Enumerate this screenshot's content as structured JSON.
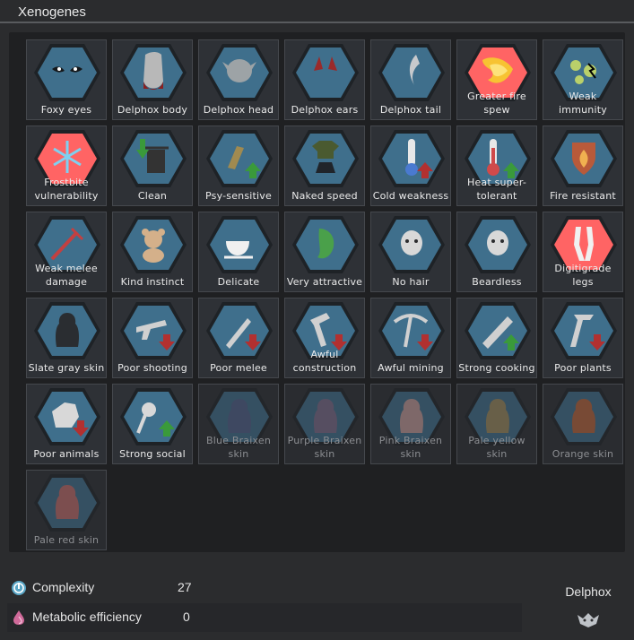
{
  "header": {
    "title": "Xenogenes"
  },
  "genes": [
    {
      "label": "Foxy eyes",
      "icon": "foxy-eyes-icon",
      "dim": false
    },
    {
      "label": "Delphox body",
      "icon": "delphox-body-icon",
      "dim": false
    },
    {
      "label": "Delphox head",
      "icon": "delphox-head-icon",
      "dim": false
    },
    {
      "label": "Delphox ears",
      "icon": "delphox-ears-icon",
      "dim": false
    },
    {
      "label": "Delphox tail",
      "icon": "delphox-tail-icon",
      "dim": false
    },
    {
      "label": "Greater fire spew",
      "icon": "fire-spew-icon",
      "dim": false
    },
    {
      "label": "Weak immunity",
      "icon": "weak-immunity-icon",
      "dim": false
    },
    {
      "label": "Frostbite vulnerability",
      "icon": "frostbite-icon",
      "dim": false
    },
    {
      "label": "Clean",
      "icon": "trash-can-icon",
      "dim": false
    },
    {
      "label": "Psy-sensitive",
      "icon": "psy-sensitive-icon",
      "dim": false
    },
    {
      "label": "Naked speed",
      "icon": "naked-speed-icon",
      "dim": false
    },
    {
      "label": "Cold weakness",
      "icon": "cold-thermometer-icon",
      "dim": false
    },
    {
      "label": "Heat super-tolerant",
      "icon": "heat-thermometer-icon",
      "dim": false
    },
    {
      "label": "Fire resistant",
      "icon": "fire-shield-icon",
      "dim": false
    },
    {
      "label": "Weak melee damage",
      "icon": "weak-melee-icon",
      "dim": false
    },
    {
      "label": "Kind instinct",
      "icon": "teddy-bear-icon",
      "dim": false
    },
    {
      "label": "Delicate",
      "icon": "teacup-icon",
      "dim": false
    },
    {
      "label": "Very attractive",
      "icon": "attractive-icon",
      "dim": false
    },
    {
      "label": "No hair",
      "icon": "no-hair-icon",
      "dim": false
    },
    {
      "label": "Beardless",
      "icon": "beardless-icon",
      "dim": false
    },
    {
      "label": "Digitigrade legs",
      "icon": "digitigrade-legs-icon",
      "dim": false
    },
    {
      "label": "Slate gray skin",
      "icon": "skin-slate-icon",
      "dim": false
    },
    {
      "label": "Poor shooting",
      "icon": "poor-shooting-icon",
      "dim": false
    },
    {
      "label": "Poor melee",
      "icon": "poor-melee-icon",
      "dim": false
    },
    {
      "label": "Awful construction",
      "icon": "awful-construction-icon",
      "dim": false
    },
    {
      "label": "Awful mining",
      "icon": "awful-mining-icon",
      "dim": false
    },
    {
      "label": "Strong cooking",
      "icon": "strong-cooking-icon",
      "dim": false
    },
    {
      "label": "Poor plants",
      "icon": "poor-plants-icon",
      "dim": false
    },
    {
      "label": "Poor animals",
      "icon": "poor-animals-icon",
      "dim": false
    },
    {
      "label": "Strong social",
      "icon": "strong-social-icon",
      "dim": false
    },
    {
      "label": "Blue Braixen skin",
      "icon": "skin-blue-icon",
      "dim": true
    },
    {
      "label": "Purple Braixen skin",
      "icon": "skin-purple-icon",
      "dim": true
    },
    {
      "label": "Pink Braixen skin",
      "icon": "skin-pink-icon",
      "dim": true
    },
    {
      "label": "Pale yellow skin",
      "icon": "skin-pale-yellow-icon",
      "dim": true
    },
    {
      "label": "Orange skin",
      "icon": "skin-orange-icon",
      "dim": true
    },
    {
      "label": "Pale red skin",
      "icon": "skin-pale-red-icon",
      "dim": true
    }
  ],
  "stats": {
    "complexity": {
      "label": "Complexity",
      "value": "27",
      "icon": "complexity-icon"
    },
    "metabolic": {
      "label": "Metabolic efficiency",
      "value": "0",
      "icon": "metabolism-icon"
    }
  },
  "xenotype": {
    "name": "Delphox",
    "icon": "xenotype-icon"
  },
  "colors": {
    "hex_fill": "#3f6f8c",
    "hex_border": "#1e2226",
    "bad_fill": "#ff6464",
    "down_arrow": "#b23030",
    "up_arrow": "#3a9a3a"
  }
}
